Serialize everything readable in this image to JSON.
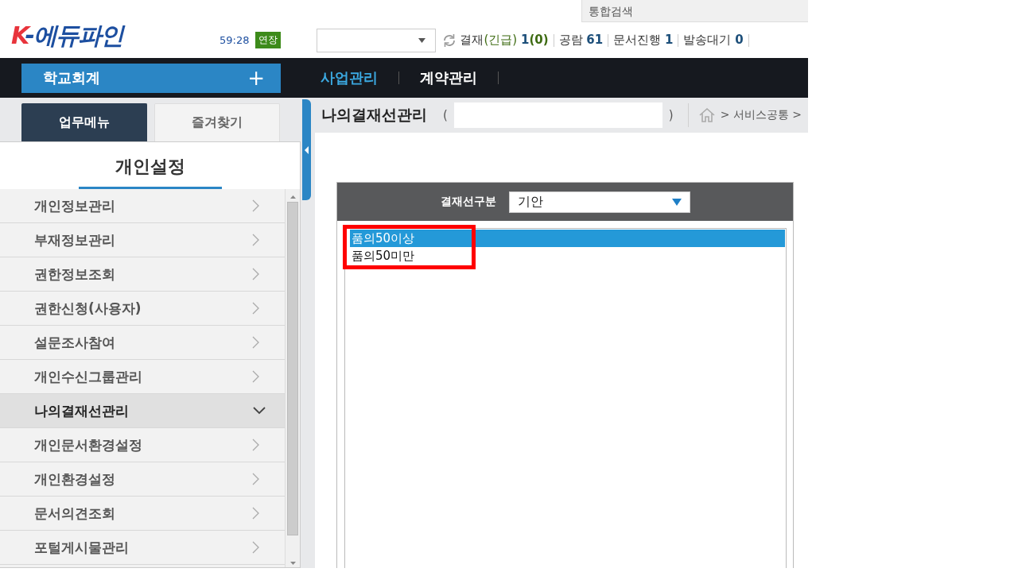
{
  "header": {
    "logo": "K-에듀파인",
    "timer": "59:28",
    "extend_badge": "연장",
    "search": {
      "placeholder": "통합검색"
    },
    "status_items": [
      {
        "label": "결재",
        "urgent_label": "(긴급)",
        "count": "1",
        "urgent_count": "(0)"
      },
      {
        "label": "공람",
        "count": "61"
      },
      {
        "label": "문서진행",
        "count": "1"
      },
      {
        "label": "발송대기",
        "count": "0"
      }
    ]
  },
  "nav": {
    "module": {
      "label": "학교회계",
      "icon": "+"
    },
    "tabs": [
      {
        "label": "사업관리",
        "selected": true
      },
      {
        "label": "계약관리",
        "selected": false
      }
    ]
  },
  "sidebar": {
    "tabs": [
      {
        "label": "업무메뉴",
        "selected": true
      },
      {
        "label": "즐겨찾기",
        "selected": false
      }
    ],
    "title": "개인설정",
    "items": [
      {
        "label": "개인정보관리",
        "expanded": false
      },
      {
        "label": "부재정보관리",
        "expanded": false
      },
      {
        "label": "권한정보조회",
        "expanded": false
      },
      {
        "label": "권한신청(사용자)",
        "expanded": false
      },
      {
        "label": "설문조사참여",
        "expanded": false
      },
      {
        "label": "개인수신그룹관리",
        "expanded": false
      },
      {
        "label": "나의결재선관리",
        "expanded": true
      },
      {
        "label": "개인문서환경설정",
        "expanded": false
      },
      {
        "label": "개인환경설정",
        "expanded": false
      },
      {
        "label": "문서의견조회",
        "expanded": false
      },
      {
        "label": "포털게시물관리",
        "expanded": false
      }
    ]
  },
  "content": {
    "title": "나의결재선관리",
    "open_paren": "(",
    "close_paren": ")",
    "breadcrumb": "> 서비스공통 >",
    "filter": {
      "label": "결재선구분",
      "value": "기안"
    },
    "options": [
      {
        "label": "품의50이상",
        "selected": true
      },
      {
        "label": "품의50미만",
        "selected": false
      }
    ]
  }
}
